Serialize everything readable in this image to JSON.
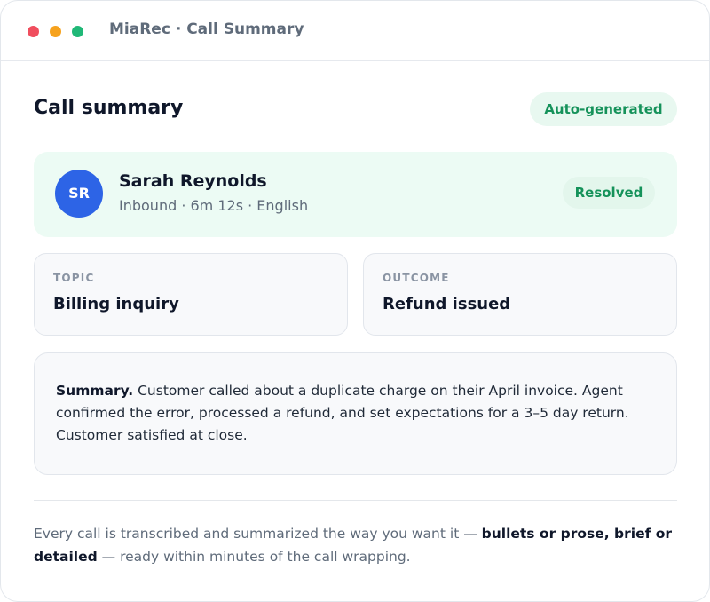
{
  "window": {
    "title": "MiaRec · Call Summary"
  },
  "header": {
    "title": "Call summary",
    "badge": "Auto-generated"
  },
  "caller": {
    "initials": "SR",
    "name": "Sarah Reynolds",
    "meta": "Inbound · 6m 12s · English",
    "status": "Resolved"
  },
  "topic": {
    "label": "TOPIC",
    "value": "Billing inquiry"
  },
  "outcome": {
    "label": "OUTCOME",
    "value": "Refund issued"
  },
  "summary": {
    "label": "Summary.",
    "text": " Customer called about a duplicate charge on their April invoice. Agent confirmed the error, processed a refund, and set expectations for a 3–5 day return. Customer satisfied at close."
  },
  "footer": {
    "intro": "Every call is transcribed and summarized the way you want it — ",
    "emphasis": "bullets or prose, brief or detailed",
    "outro": " — ready within minutes of the call wrapping."
  },
  "colors": {
    "accent_green": "#15925a",
    "avatar_blue": "#2d64e6",
    "dot_red": "#f04e5e",
    "dot_yellow": "#f6a21d",
    "dot_green": "#20b877"
  }
}
